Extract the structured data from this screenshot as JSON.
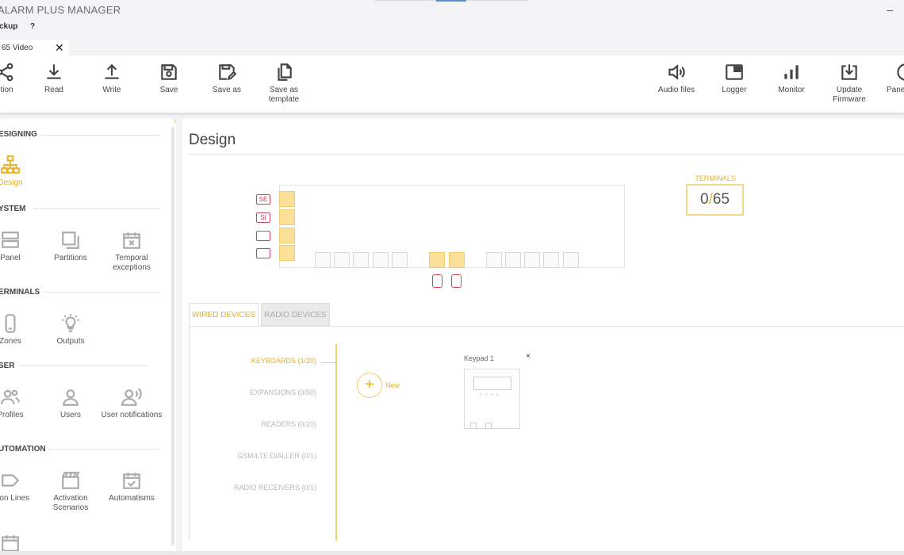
{
  "app": {
    "title": "ALARM PLUS MANAGER",
    "minimize": "–"
  },
  "menu": {
    "item1": "ckup",
    "help": "?"
  },
  "doc_tab": {
    "label": "65 Video",
    "close": "✕"
  },
  "toolbar": {
    "left": [
      "ction",
      "Read",
      "Write",
      "Save",
      "Save as",
      "Save as template"
    ],
    "right": [
      "Audio files",
      "Logger",
      "Monitor",
      "Update Firmware",
      "Pane"
    ]
  },
  "sidebar": {
    "collapse": "‹",
    "sections": {
      "designing": "ESIGNING",
      "system": "YSTEM",
      "terminals": "ERMINALS",
      "user": "SER",
      "automation": "UTOMATION"
    },
    "items": {
      "design": "Design",
      "panel": "Panel",
      "partitions": "Partitions",
      "temporal": "Temporal exceptions",
      "zones": "Zones",
      "outputs": "Outputs",
      "profiles": "Profiles",
      "users": "Users",
      "user_notifications": "User notifications",
      "activation_lines": "ation Lines",
      "activation_scenarios": "Activation Scenarios",
      "automatisms": "Automatisms"
    }
  },
  "main": {
    "title": "Design",
    "board_tags": [
      "SE",
      "SI",
      "",
      ""
    ],
    "terminals": {
      "label": "TERMINALS",
      "used": "0",
      "sep": "/",
      "total": "65"
    },
    "device_tabs": {
      "wired": "WIRED DEVICES",
      "radio": "RADIO DEVICES"
    },
    "categories": [
      "KEYBOARDS (1/20)",
      "EXPANSIONS (0/50)",
      "READERS (0/20)",
      "GSM/LTE DIALLER (0/1)",
      "RADIO RECEIVERS (0/1)"
    ],
    "new_button": {
      "plus": "+",
      "label": "New"
    },
    "keypad": {
      "label": "Keypad 1",
      "close": "×",
      "dots": "○○○○"
    }
  },
  "colors": {
    "accent": "#e2b12a",
    "tag_red": "#d0445a",
    "slot_yellow": "#fbe09a"
  }
}
